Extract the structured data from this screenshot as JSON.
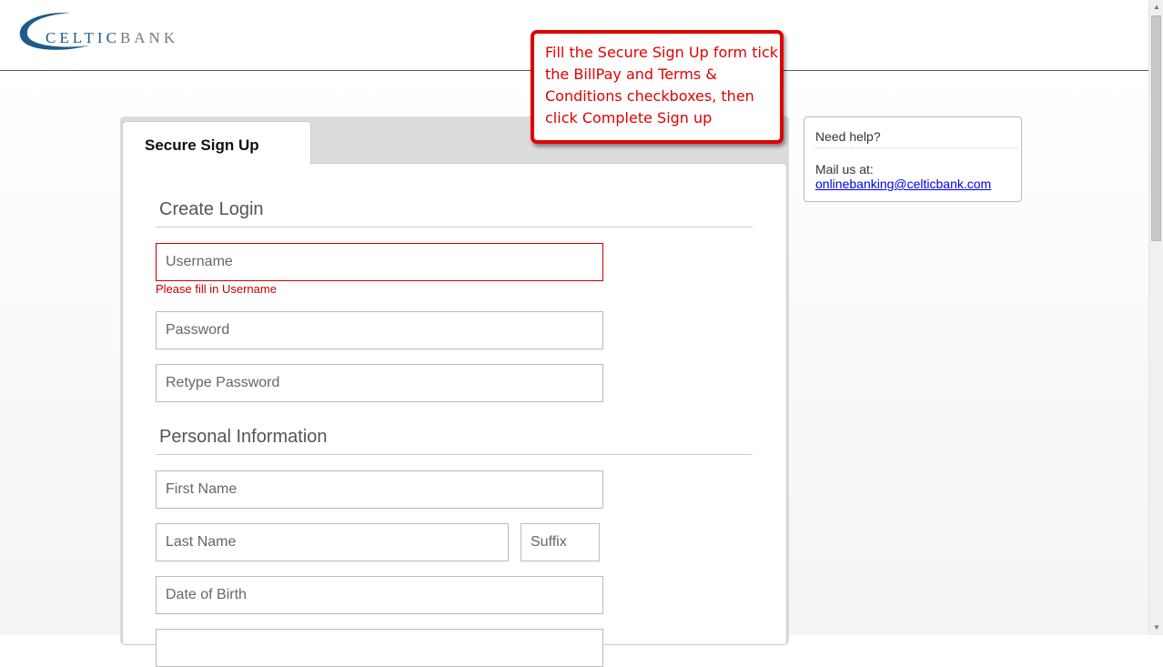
{
  "header": {
    "logo_text_celtic": "CELTIC",
    "logo_text_bank": "BANK"
  },
  "callout": {
    "text": "Fill the Secure Sign Up form tick the BillPay and Terms & Conditions checkboxes, then click Complete Sign up"
  },
  "tab": {
    "label": "Secure Sign Up"
  },
  "sections": {
    "create_login": "Create Login",
    "personal_information": "Personal Information"
  },
  "fields": {
    "username": {
      "placeholder": "Username",
      "value": "",
      "error": "Please fill in Username"
    },
    "password": {
      "placeholder": "Password",
      "value": ""
    },
    "retype_password": {
      "placeholder": "Retype Password",
      "value": ""
    },
    "first_name": {
      "placeholder": "First Name",
      "value": ""
    },
    "last_name": {
      "placeholder": "Last Name",
      "value": ""
    },
    "suffix": {
      "placeholder": "Suffix",
      "value": ""
    },
    "date_of_birth": {
      "placeholder": "Date of Birth",
      "value": ""
    }
  },
  "help": {
    "title": "Need help?",
    "mail_label": "Mail us at:",
    "email": "onlinebanking@celticbank.com"
  },
  "colors": {
    "brand_blue": "#1e5b8a",
    "error_red": "#d10000",
    "callout_red": "#e00000"
  }
}
